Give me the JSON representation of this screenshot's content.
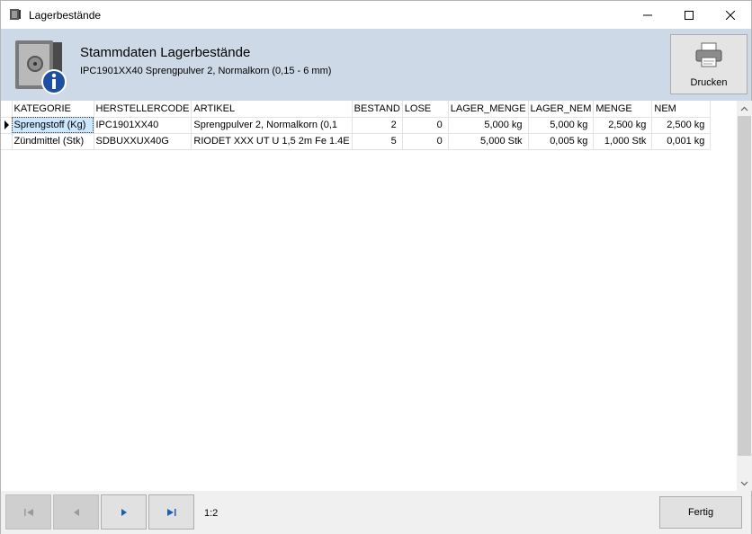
{
  "window": {
    "title": "Lagerbestände"
  },
  "header": {
    "title": "Stammdaten Lagerbestände",
    "subtitle": "IPC1901XX40 Sprengpulver 2, Normalkorn (0,15 - 6 mm)",
    "print_label": "Drucken"
  },
  "grid": {
    "columns": [
      "KATEGORIE",
      "HERSTELLERCODE",
      "ARTIKEL",
      "BESTAND",
      "LOSE",
      "LAGER_MENGE",
      "LAGER_NEM",
      "MENGE",
      "NEM"
    ],
    "rows": [
      {
        "kategorie": "Sprengstoff (Kg)",
        "herstellercode": "IPC1901XX40",
        "artikel": "Sprengpulver 2, Normalkorn (0,1",
        "bestand": "2",
        "lose": "0",
        "lager_menge": "5,000 kg",
        "lager_nem": "5,000 kg",
        "menge": "2,500 kg",
        "nem": "2,500 kg"
      },
      {
        "kategorie": "Zündmittel (Stk)",
        "herstellercode": "SDBUXXUX40G",
        "artikel": "RIODET XXX UT U 1,5 2m Fe 1.4E",
        "bestand": "5",
        "lose": "0",
        "lager_menge": "5,000 Stk",
        "lager_nem": "0,005 kg",
        "menge": "1,000 Stk",
        "nem": "0,001 kg"
      }
    ]
  },
  "footer": {
    "position": "1:2",
    "done_label": "Fertig"
  }
}
